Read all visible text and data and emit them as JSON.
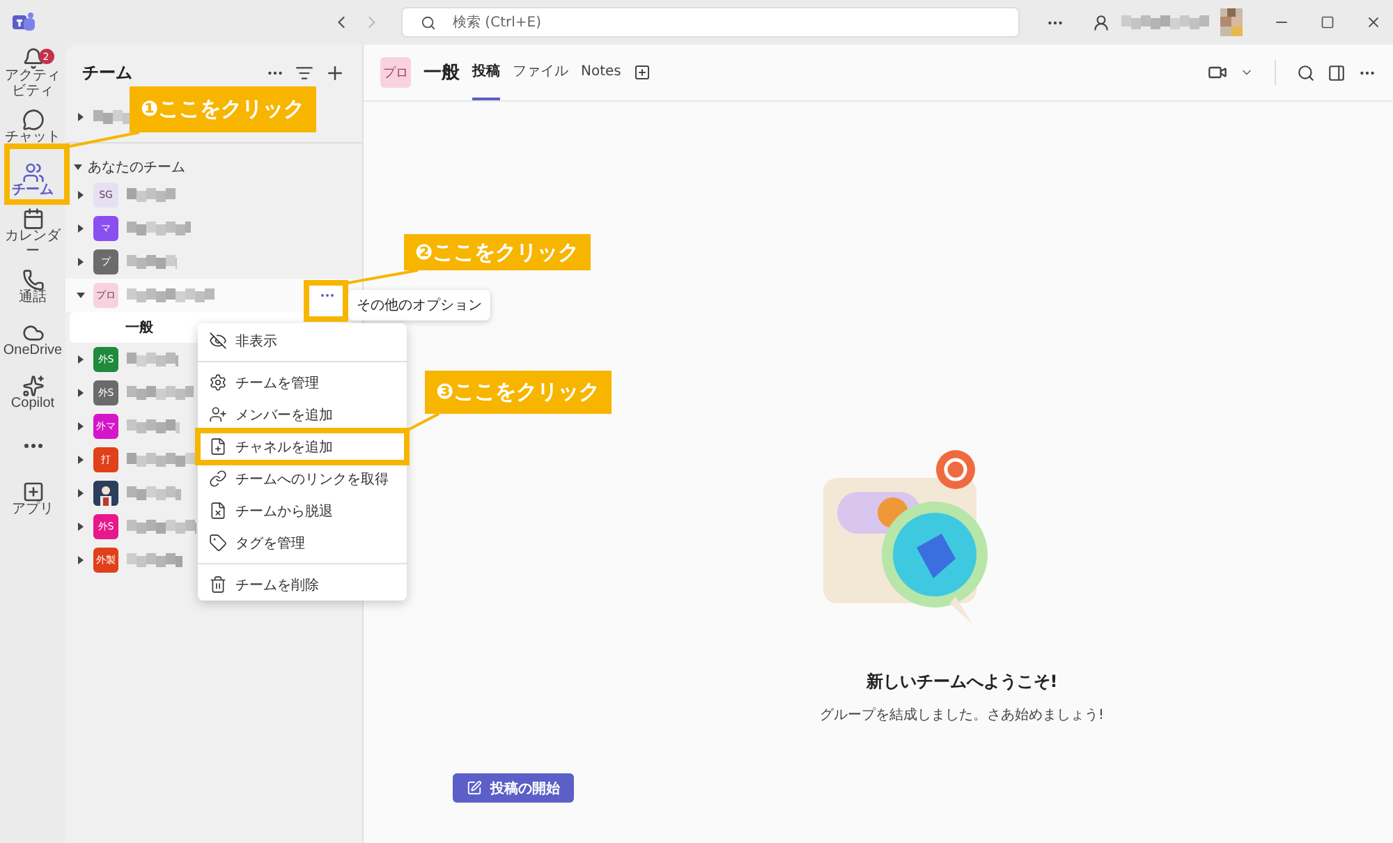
{
  "title_bar": {
    "search_placeholder": "検索 (Ctrl+E)"
  },
  "rail": [
    {
      "kind": "bell",
      "label": "アクティビティ",
      "badge": "2",
      "selected": false
    },
    {
      "kind": "chat",
      "label": "チャット",
      "selected": false
    },
    {
      "kind": "teams",
      "label": "チーム",
      "selected": true
    },
    {
      "kind": "calendar",
      "label": "カレンダー",
      "selected": false
    },
    {
      "kind": "phone",
      "label": "通話",
      "selected": false
    },
    {
      "kind": "cloud",
      "label": "OneDrive",
      "selected": false
    },
    {
      "kind": "copilot",
      "label": "Copilot",
      "selected": false
    },
    {
      "kind": "more"
    },
    {
      "kind": "apps",
      "label": "アプリ",
      "selected": false
    }
  ],
  "team_panel": {
    "title": "チーム",
    "section": "あなたのチーム",
    "section_expanded": true,
    "teams": [
      {
        "kind": "initials",
        "initials": "SG",
        "color": "#e6e1f2",
        "expanded": false,
        "hovered": false
      },
      {
        "kind": "initials",
        "initials": "マ",
        "color": "#8a4ff0",
        "expanded": false,
        "hovered": false
      },
      {
        "kind": "initials",
        "initials": "プ",
        "color": "#6b6b6b",
        "expanded": false,
        "hovered": false
      },
      {
        "kind": "initials",
        "initials": "プロ",
        "color": "#f8d3df",
        "expanded": true,
        "hovered": true,
        "channels": [
          {
            "name": "一般",
            "selected": true
          }
        ]
      },
      {
        "kind": "initials",
        "initials": "外S",
        "color": "#1f8a3c",
        "expanded": false,
        "hovered": false
      },
      {
        "kind": "initials",
        "initials": "外S",
        "color": "#6b6b6b",
        "expanded": false,
        "hovered": false
      },
      {
        "kind": "initials",
        "initials": "外マ",
        "color": "#d516c8",
        "expanded": false,
        "hovered": false
      },
      {
        "kind": "initials",
        "initials": "打",
        "color": "#e0401a",
        "expanded": false,
        "hovered": false
      },
      {
        "kind": "picture",
        "expanded": false,
        "hovered": false
      },
      {
        "kind": "initials",
        "initials": "外S",
        "color": "#e8188c",
        "expanded": false,
        "hovered": false
      },
      {
        "kind": "initials",
        "initials": "外製",
        "color": "#e0401a",
        "expanded": false,
        "hovered": false
      }
    ]
  },
  "tooltip": "その他のオプション",
  "context_menu": [
    {
      "kind": "hide",
      "label": "非表示",
      "divider_after": true
    },
    {
      "kind": "settings",
      "label": "チームを管理"
    },
    {
      "kind": "add_member",
      "label": "メンバーを追加"
    },
    {
      "kind": "add_channel",
      "label": "チャネルを追加",
      "highlighted": true
    },
    {
      "kind": "link",
      "label": "チームへのリンクを取得"
    },
    {
      "kind": "leave",
      "label": "チームから脱退"
    },
    {
      "kind": "tag",
      "label": "タグを管理",
      "divider_after": true
    },
    {
      "kind": "delete",
      "label": "チームを削除"
    }
  ],
  "channel_header": {
    "team_initials": "プロ",
    "channel": "一般",
    "tabs": [
      {
        "label": "投稿",
        "selected": true
      },
      {
        "label": "ファイル",
        "selected": false
      },
      {
        "label": "Notes",
        "selected": false
      }
    ]
  },
  "welcome": {
    "title": "新しいチームへようこそ!",
    "subtitle": "グループを結成しました。さあ始めましょう!"
  },
  "start_post_button": "投稿の開始",
  "annotations": [
    {
      "text": "❶ここをクリック"
    },
    {
      "text": "❷ここをクリック"
    },
    {
      "text": "❸ここをクリック"
    }
  ]
}
